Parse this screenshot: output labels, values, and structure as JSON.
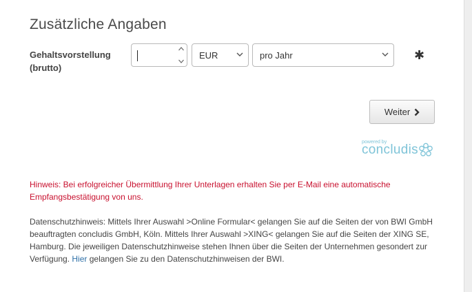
{
  "section": {
    "title": "Zusätzliche Angaben"
  },
  "salary": {
    "label": "Gehaltsvorstellung (brutto)",
    "amount_value": "",
    "currency": "EUR",
    "period": "pro Jahr",
    "required_marker": "✱"
  },
  "navigation": {
    "next_label": "Weiter"
  },
  "branding": {
    "powered_by": "powered by",
    "name": "concludis"
  },
  "notice": {
    "hint": "Hinweis: Bei erfolgreicher Übermittlung Ihrer Unterlagen erhalten Sie per E-Mail eine automatische Empfangsbestätigung von uns."
  },
  "privacy": {
    "text_before": "Datenschutzhinweis: Mittels Ihrer Auswahl >Online Formular< gelangen Sie auf die Seiten der von BWI GmbH beauftragten concludis GmbH, Köln. Mittels Ihrer Auswahl >XING< gelangen Sie auf die Seiten der XING SE, Hamburg. Die jeweiligen Datenschutzhinweise stehen Ihnen über die Seiten der Unternehmen gesondert zur Verfügung. ",
    "link_label": "Hier",
    "text_after": " gelangen Sie zu den Datenschutzhinweisen der BWI."
  },
  "colors": {
    "hint": "#c8102e",
    "brand": "#7fc4d8",
    "link": "#2e6fa7"
  },
  "icons": {
    "stepper": "up-down-arrows-icon",
    "dropdown": "chevron-down-icon",
    "next": "chevron-right-icon",
    "brand": "concludis-flower-icon"
  }
}
